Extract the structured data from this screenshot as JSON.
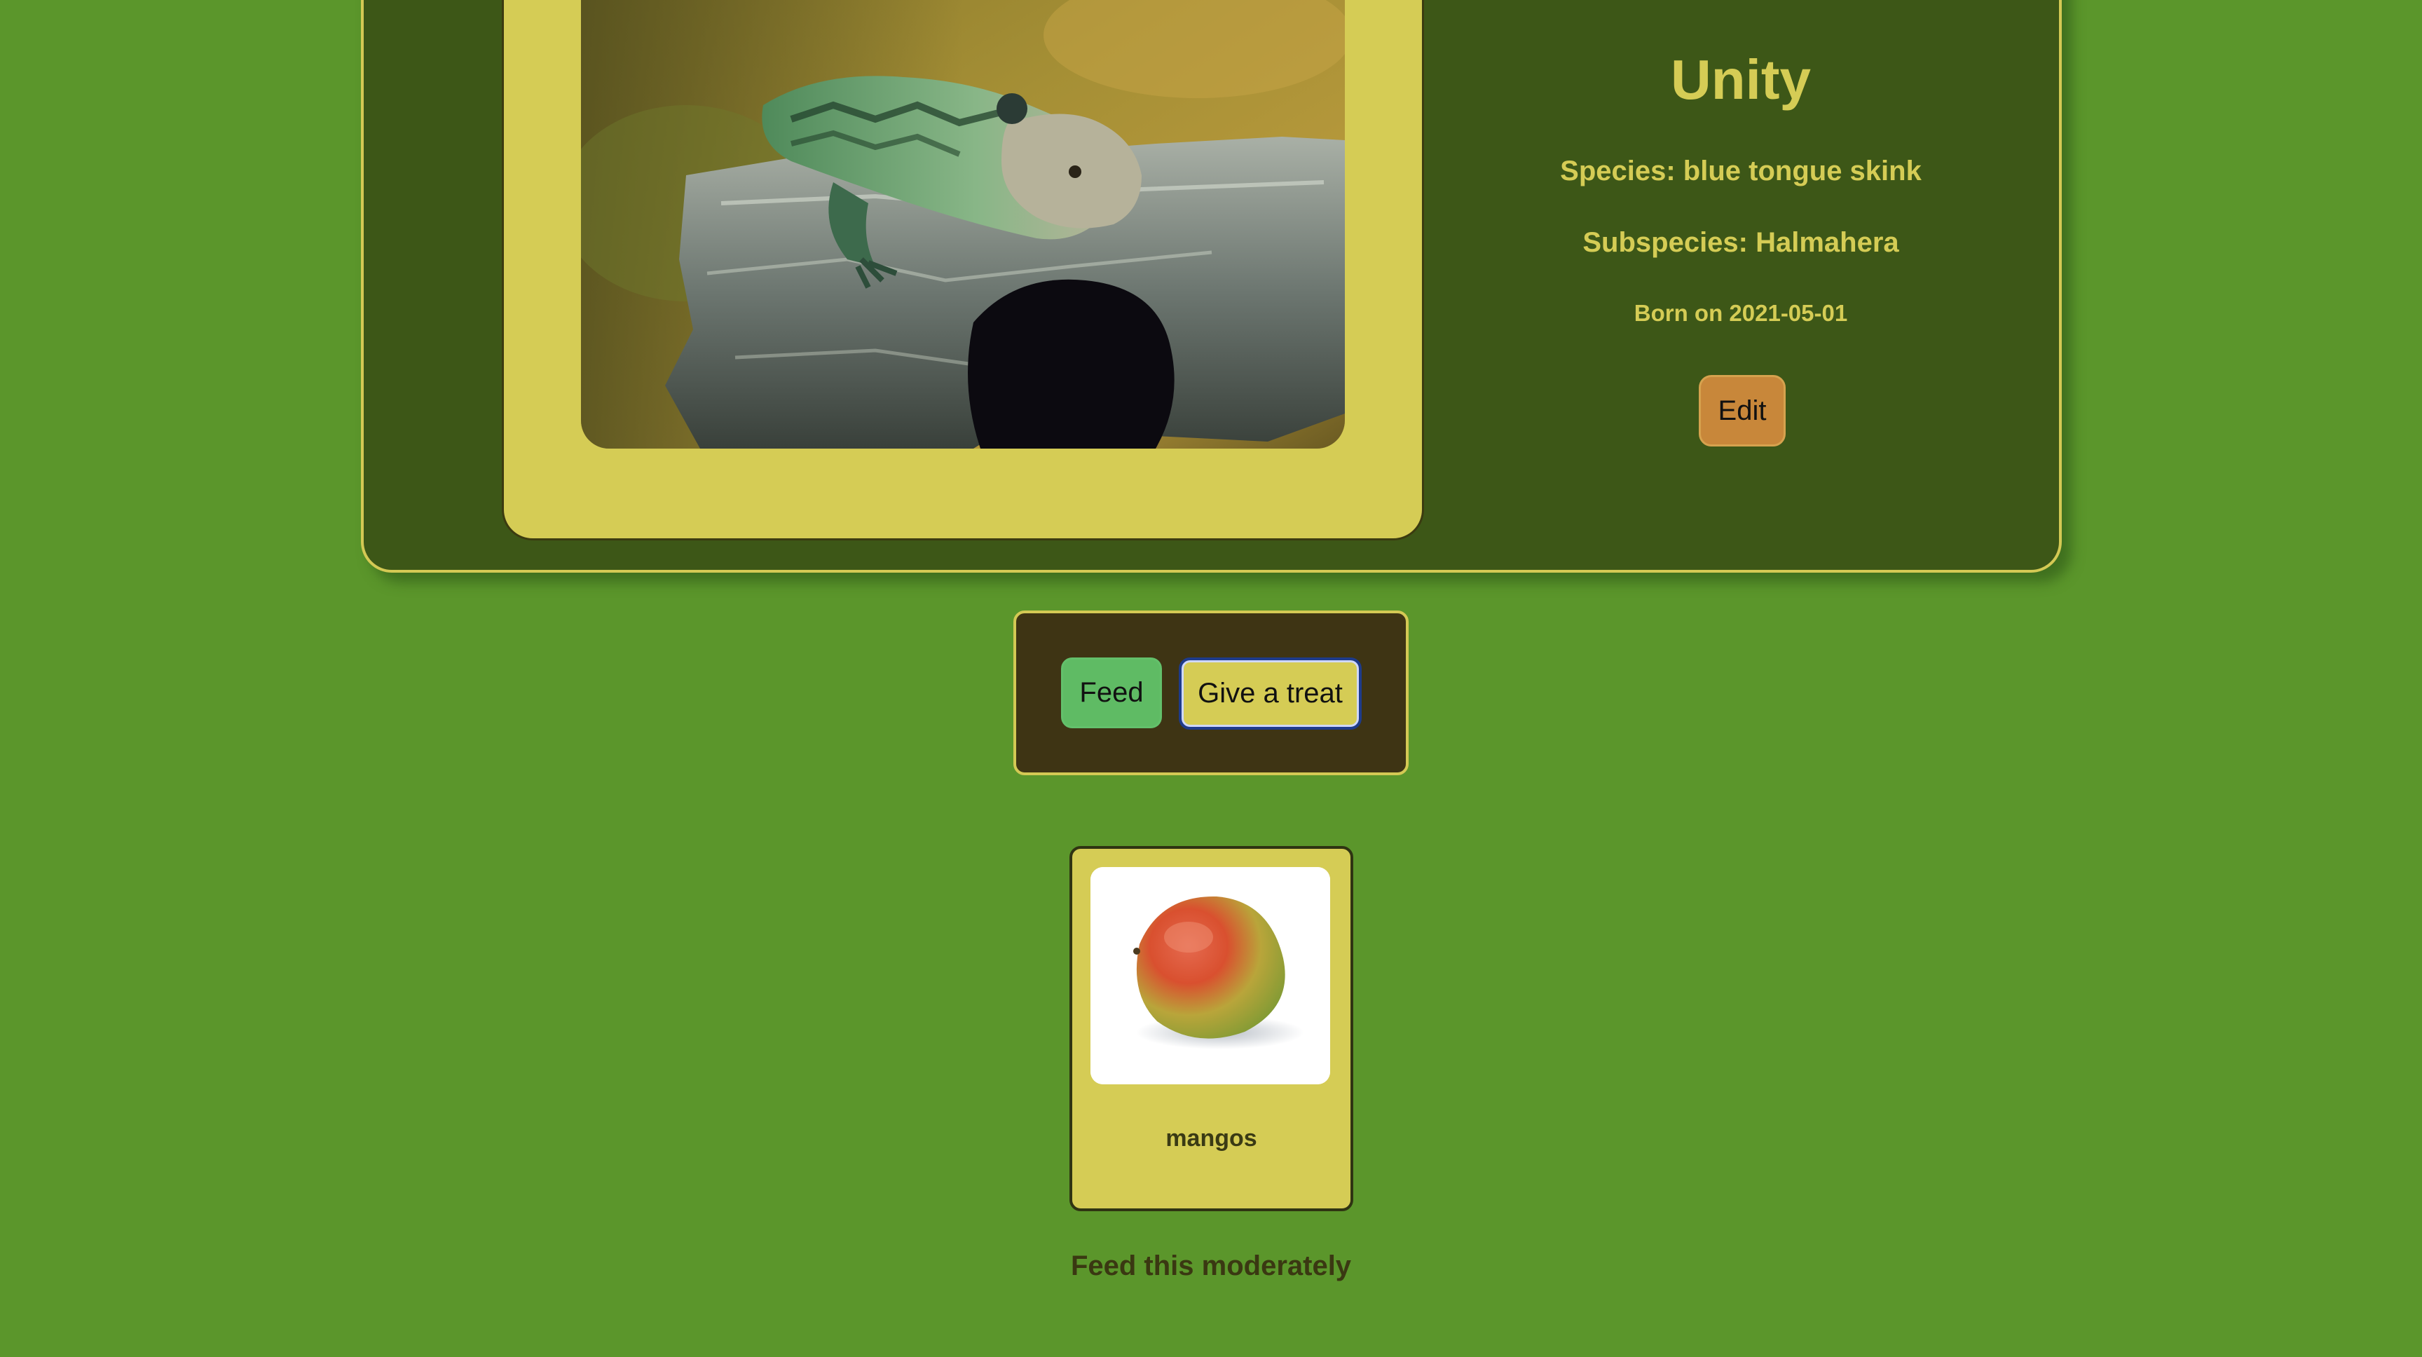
{
  "pet": {
    "name": "Unity",
    "species": "Species: blue tongue skink",
    "subspecies": "Subspecies: Halmahera",
    "born": "Born on 2021-05-01",
    "edit_label": "Edit",
    "photo_icon": "lizard-photo"
  },
  "actions": {
    "feed_label": "Feed",
    "treat_label": "Give a treat"
  },
  "food": {
    "name": "mangos",
    "image_icon": "mango-photo",
    "note": "Feed this moderately"
  },
  "colors": {
    "page_background": "#5b962b",
    "card_background": "#3d5717",
    "accent_yellow": "#d5cc55",
    "edit_button": "#c8873a",
    "feed_button": "#5fbb64",
    "action_panel": "#3e3414"
  }
}
